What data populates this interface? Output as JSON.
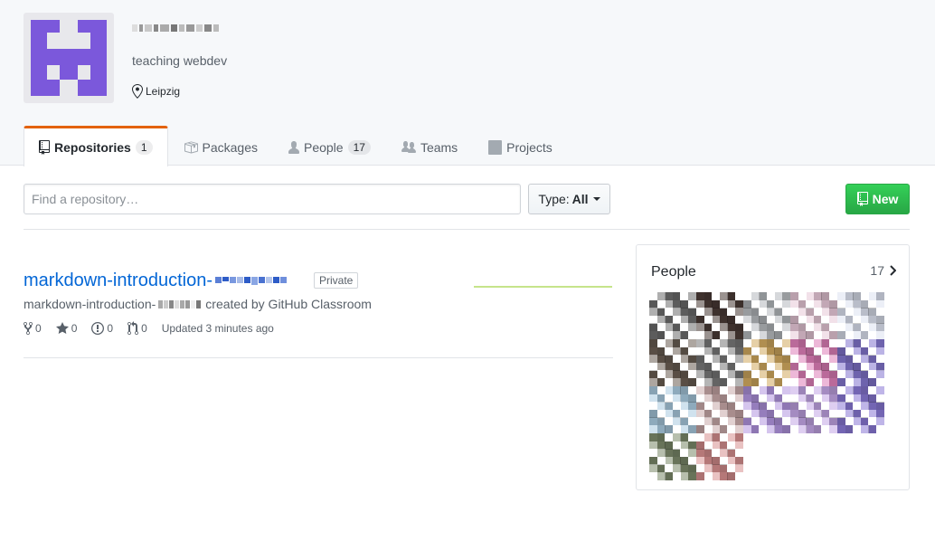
{
  "org": {
    "description": "teaching webdev",
    "location": "Leipzig",
    "brand_color": "#7b58db"
  },
  "tabs": [
    {
      "label": "Repositories",
      "count": "1",
      "icon": "repo-icon",
      "active": true
    },
    {
      "label": "Packages",
      "icon": "package-icon"
    },
    {
      "label": "People",
      "count": "17",
      "icon": "person-icon"
    },
    {
      "label": "Teams",
      "icon": "people-icon"
    },
    {
      "label": "Projects",
      "icon": "project-icon"
    }
  ],
  "toolbar": {
    "search_placeholder": "Find a repository…",
    "type_label": "Type:",
    "type_value": "All",
    "new_label": "New"
  },
  "repo": {
    "name": "markdown-introduction-",
    "visibility": "Private",
    "desc_prefix": "markdown-introduction-",
    "desc_suffix": "created by GitHub Classroom",
    "forks": "0",
    "stars": "0",
    "issues": "0",
    "pulls": "0",
    "updated": "Updated 3 minutes ago"
  },
  "people": {
    "title": "People",
    "count": "17"
  }
}
